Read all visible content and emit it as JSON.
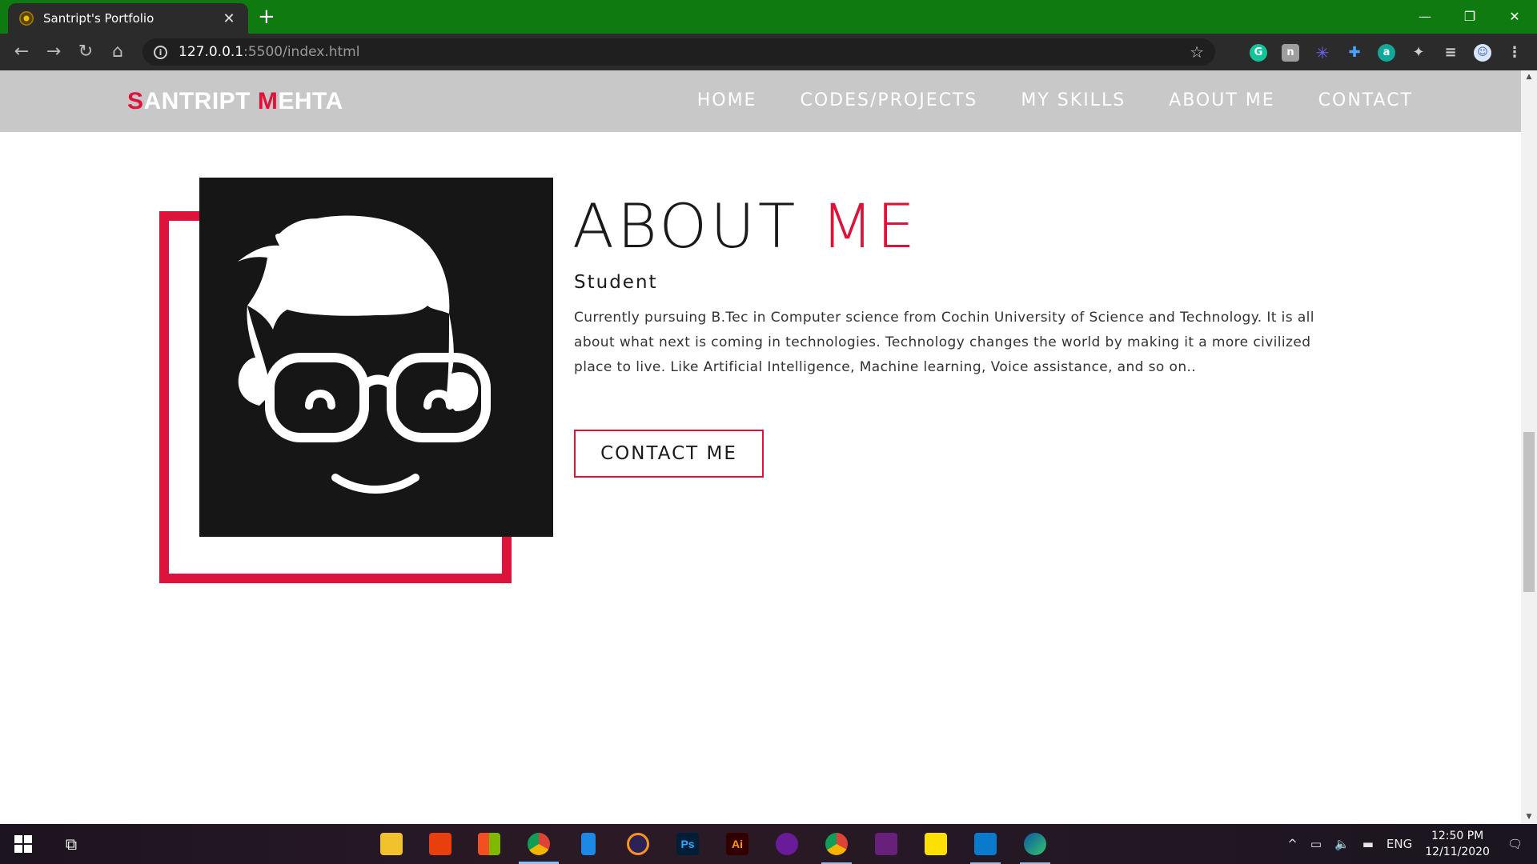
{
  "browser": {
    "tab_title": "Santript's Portfolio",
    "tab_close": "✕",
    "new_tab": "+",
    "url_host": "127.0.0.1",
    "url_path": ":5500/index.html",
    "win_min": "—",
    "win_restore": "❐",
    "win_close": "✕"
  },
  "site": {
    "brand_first_initial": "S",
    "brand_first_rest": "ANTRIPT ",
    "brand_last_initial": "M",
    "brand_last_rest": "EHTA",
    "menu": [
      "HOME",
      "CODES/PROJECTS",
      "MY SKILLS",
      "ABOUT ME",
      "CONTACT"
    ],
    "accent_color": "#dc143c"
  },
  "about": {
    "title_main": "ABOUT ",
    "title_accent": "ME",
    "role": "Student",
    "description": "Currently pursuing B.Tec in Computer science from Cochin University of Science and Technology. It is all about what next is coming in technologies. Technology changes the world by making it a more civilized place to live. Like Artificial Intelligence, Machine learning, Voice assistance, and so on..",
    "button_label": "CONTACT ME"
  },
  "taskbar": {
    "language": "ENG",
    "time": "12:50 PM",
    "date": "12/11/2020"
  }
}
